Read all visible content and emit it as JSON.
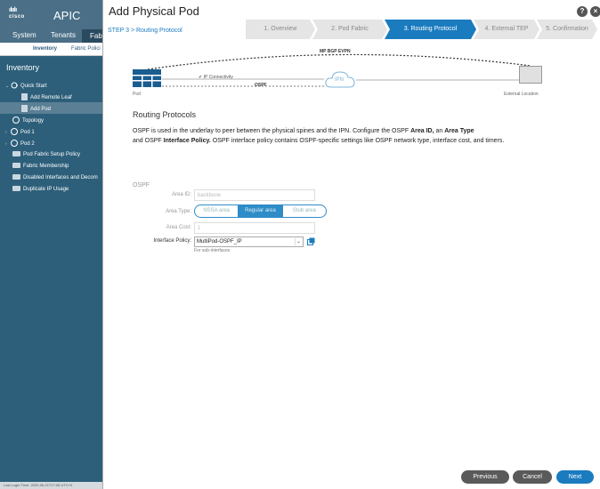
{
  "app": {
    "brand": "cisco",
    "title": "APIC",
    "tabs": [
      "System",
      "Tenants",
      "Fab"
    ],
    "subtabs": [
      "Inventory",
      "Fabric Polici"
    ],
    "sidebar_title": "Inventory",
    "sidebar_items": [
      {
        "label": "Quick Start",
        "icon": "quickstart-icon",
        "selected": false
      },
      {
        "label": "Add Remote Leaf",
        "icon": "doc-icon",
        "selected": false
      },
      {
        "label": "Add Pod",
        "icon": "doc-icon",
        "selected": true
      },
      {
        "label": "Topology",
        "icon": "topology-icon",
        "selected": false
      },
      {
        "label": "Pod 1",
        "icon": "globe-icon",
        "selected": false
      },
      {
        "label": "Pod 2",
        "icon": "globe-icon",
        "selected": false
      },
      {
        "label": "Pod Fabric Setup Policy",
        "icon": "folder-icon",
        "selected": false
      },
      {
        "label": "Fabric Membership",
        "icon": "folder-icon",
        "selected": false
      },
      {
        "label": "Disabled Interfaces and Decom",
        "icon": "folder-icon",
        "selected": false
      },
      {
        "label": "Duplicate IP Usage",
        "icon": "folder-icon",
        "selected": false
      }
    ],
    "status": "Last Login Time: 2020-06-21T17:08 UTC+0"
  },
  "dialog": {
    "title": "Add Physical Pod",
    "help": "?",
    "close": "×",
    "step_label": "STEP 3 > Routing Protocol",
    "wizard_steps": [
      {
        "label": "1. Overview",
        "active": false
      },
      {
        "label": "2. Pod Fabric",
        "active": false
      },
      {
        "label": "3. Routing Protocol",
        "active": true
      },
      {
        "label": "4. External TEP",
        "active": false
      },
      {
        "label": "5. Confirmation",
        "active": false
      }
    ],
    "topology": {
      "mpbgp": "MP BGP EVPN",
      "ip_connectivity": "IP Connectivity",
      "ospf": "OSPF",
      "ipn": "IPN",
      "pod": "Pod",
      "external": "External Location"
    },
    "section_title": "Routing Protocols",
    "desc": {
      "p1": "OSPF is used in the underlay to peer between the physical spines and the IPN. Configure the OSPF ",
      "b1": "Area ID,",
      "p2": " an ",
      "b2": "Area Type",
      "p3": "and OSPF ",
      "b3": "Interface Policy.",
      "p4": " OSPF interface policy contains OSPF-specific settings like OSPF network type, interface cost, and timers."
    },
    "ospf": {
      "title": "OSPF",
      "area_id_label": "Area ID:",
      "area_id_value": "backbone",
      "area_type_label": "Area Type:",
      "area_types": [
        "NSSA area",
        "Regular area",
        "Stub area"
      ],
      "area_type_selected": "Regular area",
      "area_cost_label": "Area Cost:",
      "area_cost_value": "1",
      "policy_label": "Interface Policy:",
      "policy_value": "MultiPod-OSPF_IP",
      "policy_hint": "For sub-interfaces"
    },
    "buttons": {
      "previous": "Previous",
      "cancel": "Cancel",
      "next": "Next"
    }
  },
  "colors": {
    "accent": "#1a7bbf",
    "sidebar": "#2d5f7a",
    "header": "#4a6f87"
  }
}
